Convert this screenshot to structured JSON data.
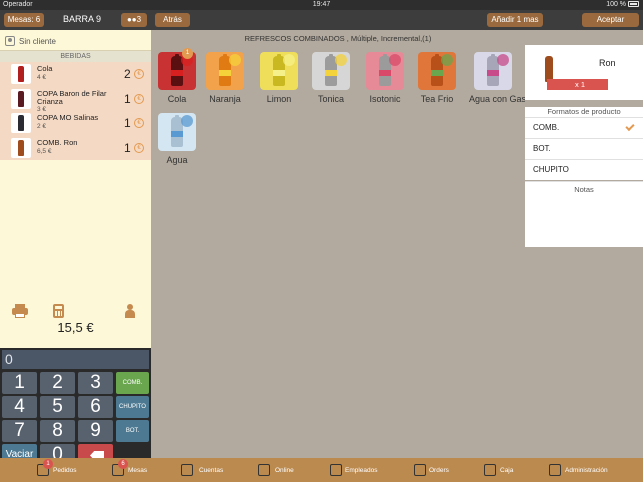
{
  "status_bar": {
    "carrier": "Operador",
    "time": "19:47",
    "battery": "100 %"
  },
  "left": {
    "mesas_label": "Mesas: 6",
    "table_name": "BARRA 9",
    "guests": "3",
    "client_label": "Sin cliente",
    "section": "BEBIDAS",
    "items": [
      {
        "name": "Cola",
        "price": "4 €",
        "qty": "2",
        "color": "#b21f1f"
      },
      {
        "name": "COPA Baron de Filar Crianza",
        "price": "3 €",
        "qty": "1",
        "color": "#5a1a22"
      },
      {
        "name": "COPA MO Salinas",
        "price": "2 €",
        "qty": "1",
        "color": "#2b2b33"
      },
      {
        "name": "COMB. Ron",
        "price": "6,5 €",
        "qty": "1",
        "color": "#9e4b1d"
      }
    ],
    "price_symbol": "€",
    "total": "15,5 €"
  },
  "keypad": {
    "display": "0",
    "keys": [
      "1",
      "2",
      "3",
      "4",
      "5",
      "6",
      "7",
      "8",
      "9",
      "0"
    ],
    "fn_comb": "COMB.",
    "fn_chupito": "CHUPITO",
    "fn_bot": "BOT.",
    "vaciar": "Vaciar"
  },
  "center": {
    "back_label": "Atrás",
    "title": "REFRESCOS COMBINADOS , Múltiple, Incremental,(1)",
    "products": [
      {
        "name": "Cola",
        "tile": "#c83232",
        "bottle": "#5a1010",
        "band": "#d92020",
        "badge": "1"
      },
      {
        "name": "Naranja",
        "tile": "#f2a24a",
        "bottle": "#e07a12",
        "band": "#f5d23a"
      },
      {
        "name": "Limon",
        "tile": "#eede5a",
        "bottle": "#c9b820",
        "band": "#f5f08a"
      },
      {
        "name": "Tonica",
        "tile": "#d6d6d6",
        "bottle": "#9c9c9c",
        "band": "#f3d23a"
      },
      {
        "name": "Isotonic",
        "tile": "#e68a98",
        "bottle": "#9b9b9b",
        "band": "#d94a6a"
      },
      {
        "name": "Tea Frio",
        "tile": "#e0763a",
        "bottle": "#b8501a",
        "band": "#6aa64e"
      },
      {
        "name": "Agua con Gas",
        "tile": "#d8d8e8",
        "bottle": "#a6a6b8",
        "band": "#c84a8a"
      },
      {
        "name": "Agua",
        "tile": "#d4e6f2",
        "bottle": "#a8c0d2",
        "band": "#5a9ad2"
      }
    ]
  },
  "right": {
    "add_label": "Añadir 1 mas",
    "accept_label": "Aceptar",
    "product_name": "Ron",
    "qty_label": "x 1",
    "formats_title": "Formatos de producto",
    "formats": [
      {
        "label": "COMB.",
        "selected": true
      },
      {
        "label": "BOT.",
        "selected": false
      },
      {
        "label": "CHUPITO",
        "selected": false
      }
    ],
    "notes_title": "Notas"
  },
  "bottom_nav": [
    {
      "label": "Pedidos",
      "badge": "1"
    },
    {
      "label": "Mesas",
      "badge": "6"
    },
    {
      "label": "Cuentas"
    },
    {
      "label": "Online"
    },
    {
      "label": "Empleados"
    },
    {
      "label": "Orders"
    },
    {
      "label": "Caja"
    },
    {
      "label": "Administración"
    }
  ],
  "colors": {
    "brown": "#9a6a3e",
    "nav": "#bb8a4f",
    "accent": "#e39a50",
    "red": "#d9544f"
  }
}
